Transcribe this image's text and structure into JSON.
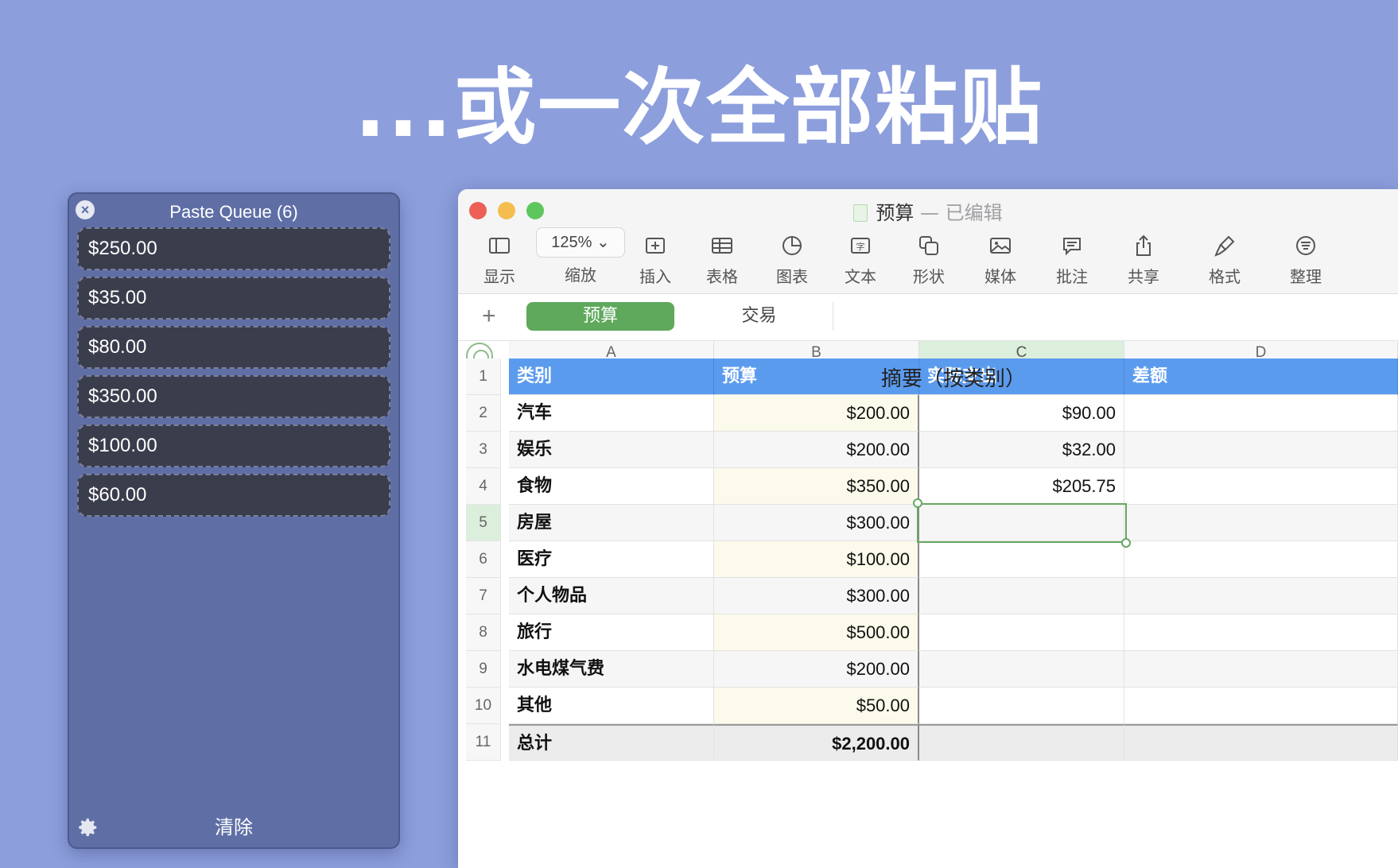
{
  "headline": "...或一次全部粘贴",
  "paste_queue": {
    "title": "Paste Queue (6)",
    "items": [
      "$250.00",
      "$35.00",
      "$80.00",
      "$350.00",
      "$100.00",
      "$60.00"
    ],
    "clear_label": "清除",
    "close_icon": "close-icon",
    "settings_icon": "gear-icon"
  },
  "window": {
    "doc_name": "预算",
    "doc_sep": " — ",
    "doc_status": "已编辑",
    "toolbar": {
      "view": "显示",
      "zoom_value": "125%",
      "zoom": "缩放",
      "insert": "插入",
      "table": "表格",
      "chart": "图表",
      "text": "文本",
      "shape": "形状",
      "media": "媒体",
      "comment": "批注",
      "share": "共享",
      "format": "格式",
      "organize": "整理"
    },
    "sheets": {
      "add": "+",
      "active": "预算",
      "other": "交易"
    }
  },
  "sheet": {
    "columns": [
      "A",
      "B",
      "C",
      "D"
    ],
    "title": "摘要（按类别）",
    "header_row": [
      "类别",
      "预算",
      "实际支出",
      "差额"
    ],
    "rows": [
      {
        "n": "2",
        "cat": "汽车",
        "budget": "$200.00",
        "actual": "$90.00",
        "diff": ""
      },
      {
        "n": "3",
        "cat": "娱乐",
        "budget": "$200.00",
        "actual": "$32.00",
        "diff": ""
      },
      {
        "n": "4",
        "cat": "食物",
        "budget": "$350.00",
        "actual": "$205.75",
        "diff": ""
      },
      {
        "n": "5",
        "cat": "房屋",
        "budget": "$300.00",
        "actual": "",
        "diff": ""
      },
      {
        "n": "6",
        "cat": "医疗",
        "budget": "$100.00",
        "actual": "",
        "diff": ""
      },
      {
        "n": "7",
        "cat": "个人物品",
        "budget": "$300.00",
        "actual": "",
        "diff": ""
      },
      {
        "n": "8",
        "cat": "旅行",
        "budget": "$500.00",
        "actual": "",
        "diff": ""
      },
      {
        "n": "9",
        "cat": "水电煤气费",
        "budget": "$200.00",
        "actual": "",
        "diff": ""
      },
      {
        "n": "10",
        "cat": "其他",
        "budget": "$50.00",
        "actual": "",
        "diff": ""
      }
    ],
    "total": {
      "n": "11",
      "cat": "总计",
      "budget": "$2,200.00",
      "actual": "",
      "diff": ""
    },
    "header_row_num": "1",
    "selected_col": "C",
    "selected_row": "5"
  },
  "colors": {
    "background": "#8c9edc",
    "header_blue": "#5b9bee",
    "active_tab": "#5fa95c",
    "queue_item": "#3a3d4c"
  }
}
